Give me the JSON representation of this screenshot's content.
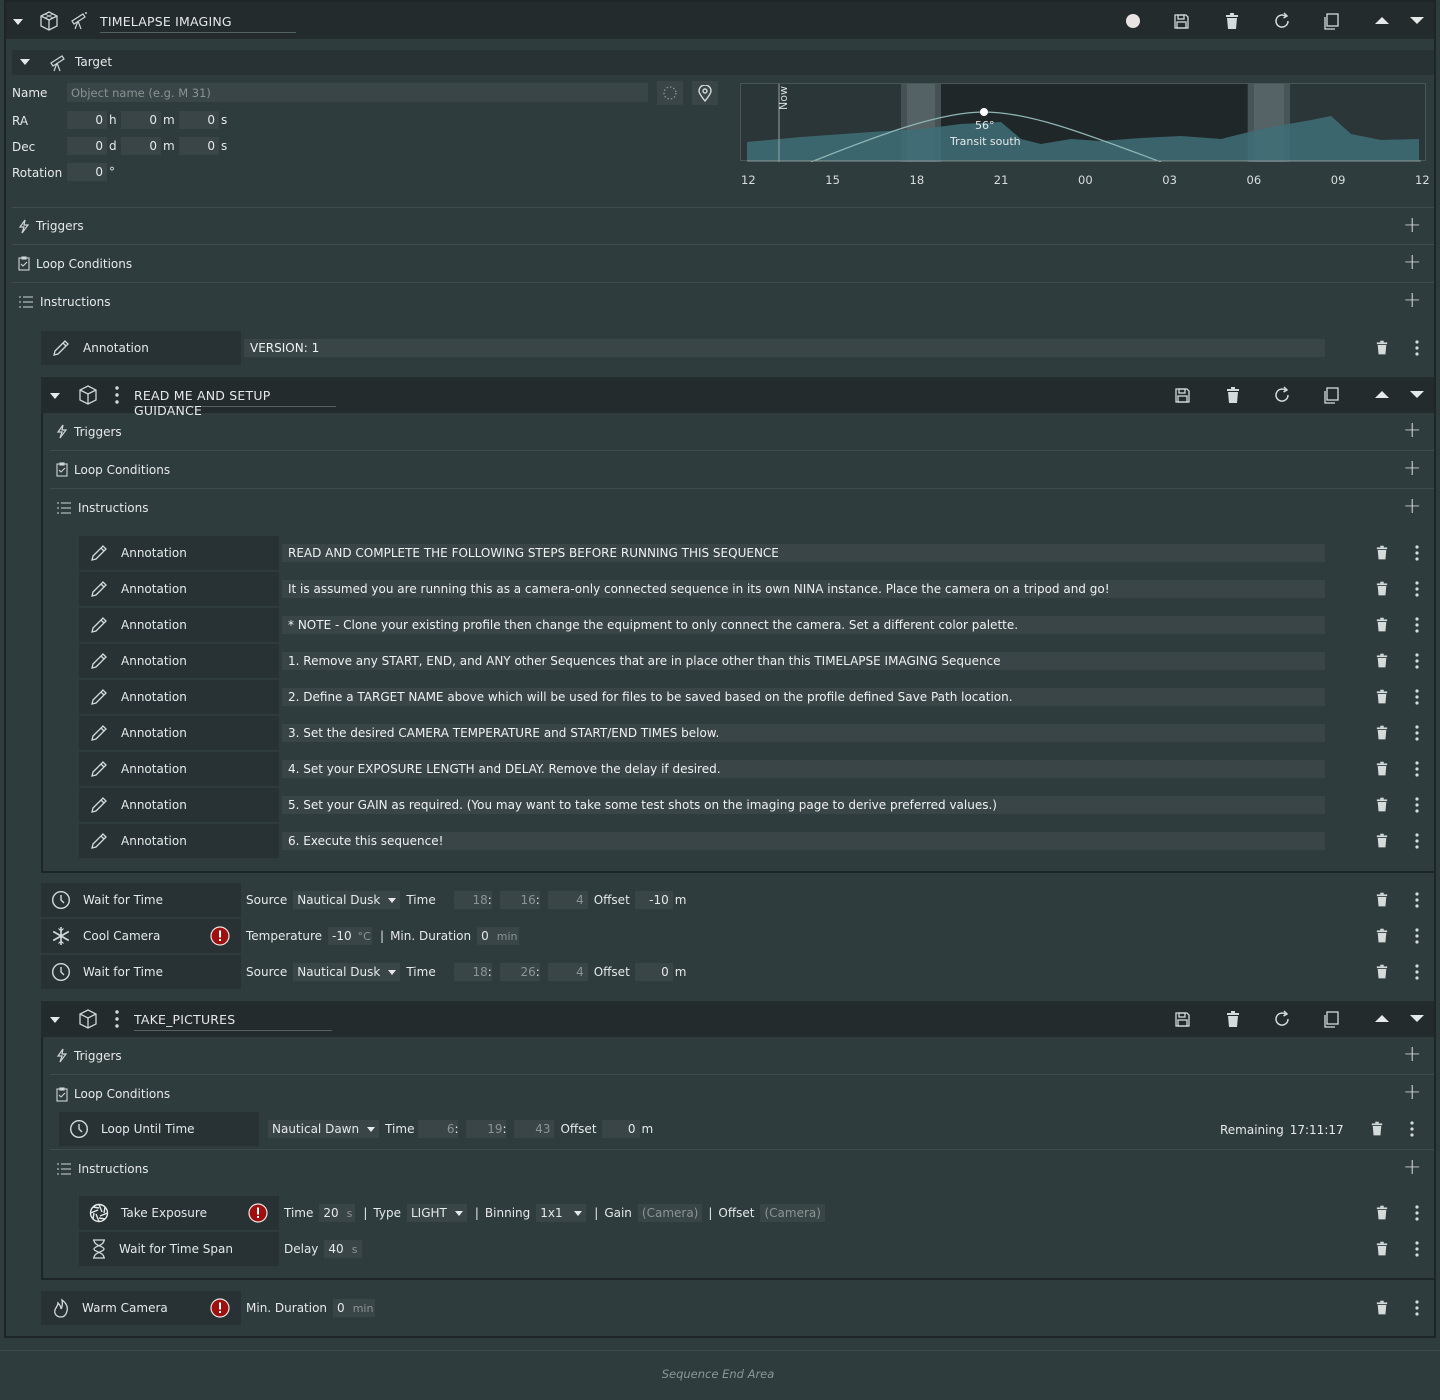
{
  "main": {
    "title": "TIMELAPSE IMAGING",
    "target": {
      "section_label": "Target",
      "name_label": "Name",
      "name_placeholder": "Object name (e.g. M 31)",
      "ra_label": "RA",
      "ra": {
        "h": "0",
        "h_unit": "h",
        "m": "0",
        "m_unit": "m",
        "s": "0",
        "s_unit": "s"
      },
      "dec_label": "Dec",
      "dec": {
        "d": "0",
        "d_unit": "d",
        "m": "0",
        "m_unit": "m",
        "s": "0",
        "s_unit": "s"
      },
      "rotation_label": "Rotation",
      "rotation": "0",
      "rotation_unit": "°",
      "altitude_chart": {
        "now_label": "Now",
        "transit_alt": "56°",
        "transit_label": "Transit south",
        "x_ticks": [
          "12",
          "15",
          "18",
          "21",
          "00",
          "03",
          "06",
          "09",
          "12"
        ]
      }
    },
    "triggers_label": "Triggers",
    "loop_label": "Loop Conditions",
    "instructions_label": "Instructions",
    "annotation_top": {
      "name": "Annotation",
      "text": "VERSION: 1"
    }
  },
  "readme": {
    "title": "READ ME AND SETUP GUIDANCE",
    "triggers_label": "Triggers",
    "loop_label": "Loop Conditions",
    "instructions_label": "Instructions",
    "annotations": [
      {
        "name": "Annotation",
        "text": "READ AND COMPLETE THE FOLLOWING STEPS BEFORE RUNNING THIS SEQUENCE"
      },
      {
        "name": "Annotation",
        "text": "It is assumed you are running this as a camera-only connected sequence in its own NINA instance. Place the camera on a tripod and go!"
      },
      {
        "name": "Annotation",
        "text": "* NOTE - Clone your existing profile then change the equipment to only connect the camera. Set a different color palette."
      },
      {
        "name": "Annotation",
        "text": "1. Remove any START, END, and ANY other Sequences that are in place other than this TIMELAPSE IMAGING Sequence"
      },
      {
        "name": "Annotation",
        "text": "2. Define a TARGET NAME above which will be used for files to be saved based on the profile defined Save Path location."
      },
      {
        "name": "Annotation",
        "text": "3. Set the desired CAMERA TEMPERATURE and START/END TIMES below."
      },
      {
        "name": "Annotation",
        "text": "4. Set your EXPOSURE LENGTH and DELAY. Remove the delay if desired."
      },
      {
        "name": "Annotation",
        "text": "5. Set your GAIN as required. (You may want to take some test shots on the imaging page to derive preferred values.)"
      },
      {
        "name": "Annotation",
        "text": "6. Execute this sequence!"
      }
    ]
  },
  "wait1": {
    "name": "Wait for Time",
    "source_label": "Source",
    "source": "Nautical Dusk",
    "time_label": "Time",
    "h": "18",
    "m": "16",
    "s": "4",
    "sep": ":",
    "offset_label": "Offset",
    "offset": "-10",
    "offset_unit": "m"
  },
  "cool": {
    "name": "Cool Camera",
    "temp_label": "Temperature",
    "temp": "-10",
    "temp_unit": "°C",
    "sep": "|",
    "dur_label": "Min. Duration",
    "dur": "0",
    "dur_unit": "min"
  },
  "wait2": {
    "name": "Wait for Time",
    "source_label": "Source",
    "source": "Nautical Dusk",
    "time_label": "Time",
    "h": "18",
    "m": "26",
    "s": "4",
    "sep": ":",
    "offset_label": "Offset",
    "offset": "0",
    "offset_unit": "m"
  },
  "take": {
    "title": "TAKE_PICTURES",
    "triggers_label": "Triggers",
    "loop_label": "Loop Conditions",
    "loop_until": {
      "name": "Loop Until Time",
      "source": "Nautical Dawn",
      "time_label": "Time",
      "h": "6",
      "m": "19",
      "s": "43",
      "sep": ":",
      "offset_label": "Offset",
      "offset": "0",
      "offset_unit": "m",
      "remaining_label": "Remaining",
      "remaining": "17:11:17"
    },
    "instructions_label": "Instructions",
    "exposure": {
      "name": "Take Exposure",
      "time_label": "Time",
      "time": "20",
      "time_unit": "s",
      "sep": "|",
      "type_label": "Type",
      "type": "LIGHT",
      "binning_label": "Binning",
      "binning": "1x1",
      "gain_label": "Gain",
      "gain": "(Camera)",
      "offset_label": "Offset",
      "offset": "(Camera)"
    },
    "wait_span": {
      "name": "Wait for Time Span",
      "delay_label": "Delay",
      "delay": "40",
      "delay_unit": "s"
    }
  },
  "warm": {
    "name": "Warm Camera",
    "dur_label": "Min. Duration",
    "dur": "0",
    "dur_unit": "min"
  },
  "end_area": "Sequence End Area"
}
